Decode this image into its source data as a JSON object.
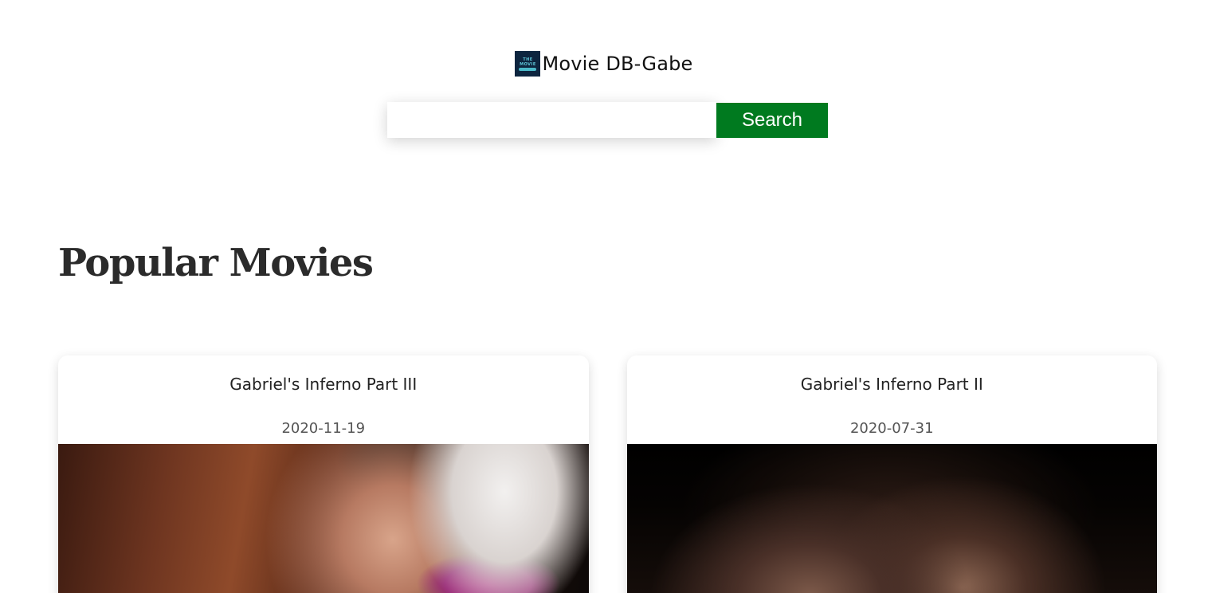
{
  "header": {
    "brand_title": "Movie DB-Gabe",
    "logo_lines": [
      "THE",
      "MOVIE",
      "DB"
    ],
    "logo_icon": "tmdb-logo-icon",
    "logo_color": "#0d253f"
  },
  "search": {
    "value": "",
    "placeholder": "",
    "button_label": "Search",
    "button_color": "#007a1f"
  },
  "main": {
    "section_title": "Popular Movies",
    "movies": [
      {
        "title": "Gabriel's Inferno Part III",
        "release_date": "2020-11-19"
      },
      {
        "title": "Gabriel's Inferno Part II",
        "release_date": "2020-07-31"
      }
    ]
  }
}
